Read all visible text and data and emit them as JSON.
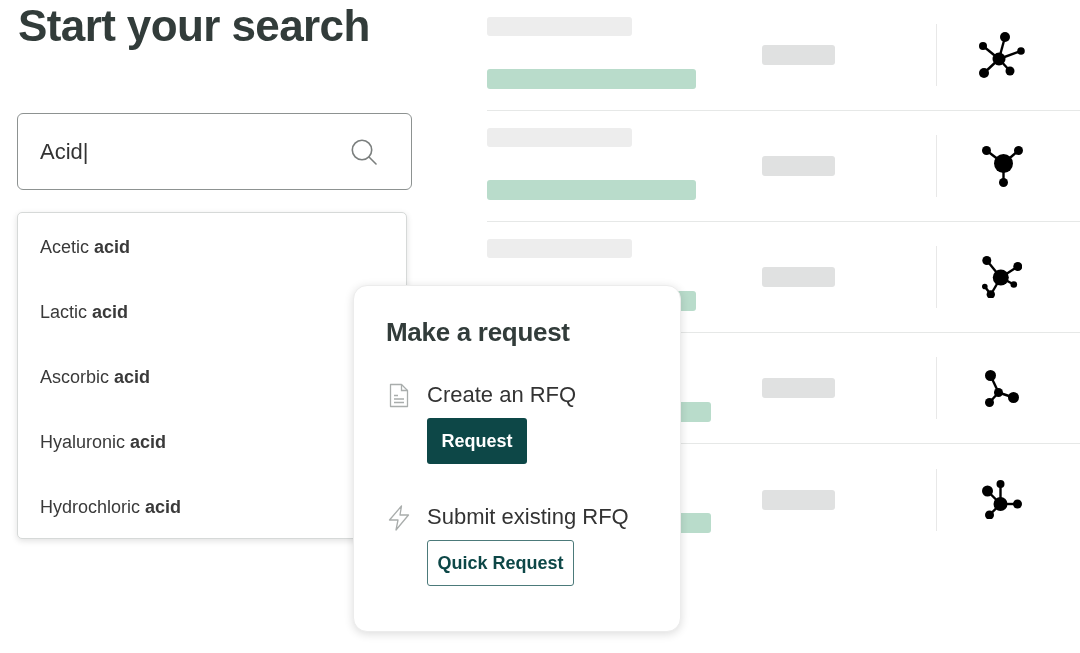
{
  "page": {
    "title": "Start your search"
  },
  "search": {
    "value": "Acid|"
  },
  "suggestions": [
    {
      "text": "Acetic **acid**",
      "selected": false
    },
    {
      "text": "Lactic **acid**",
      "selected": false
    },
    {
      "text": "Ascorbic **acid**",
      "selected": false
    },
    {
      "text": "Hyaluronic **acid**",
      "selected": false
    },
    {
      "text": "Hydrochloric **acid**",
      "selected": false
    }
  ],
  "request_popup": {
    "title": "Make a request",
    "options": [
      {
        "kind": "create",
        "label": "Create an RFQ",
        "button": {
          "label": "Request",
          "kind": "primary"
        }
      },
      {
        "kind": "submit",
        "label": "Submit existing RFQ",
        "button": {
          "label": "Quick Request",
          "kind": "outline"
        }
      }
    ]
  }
}
